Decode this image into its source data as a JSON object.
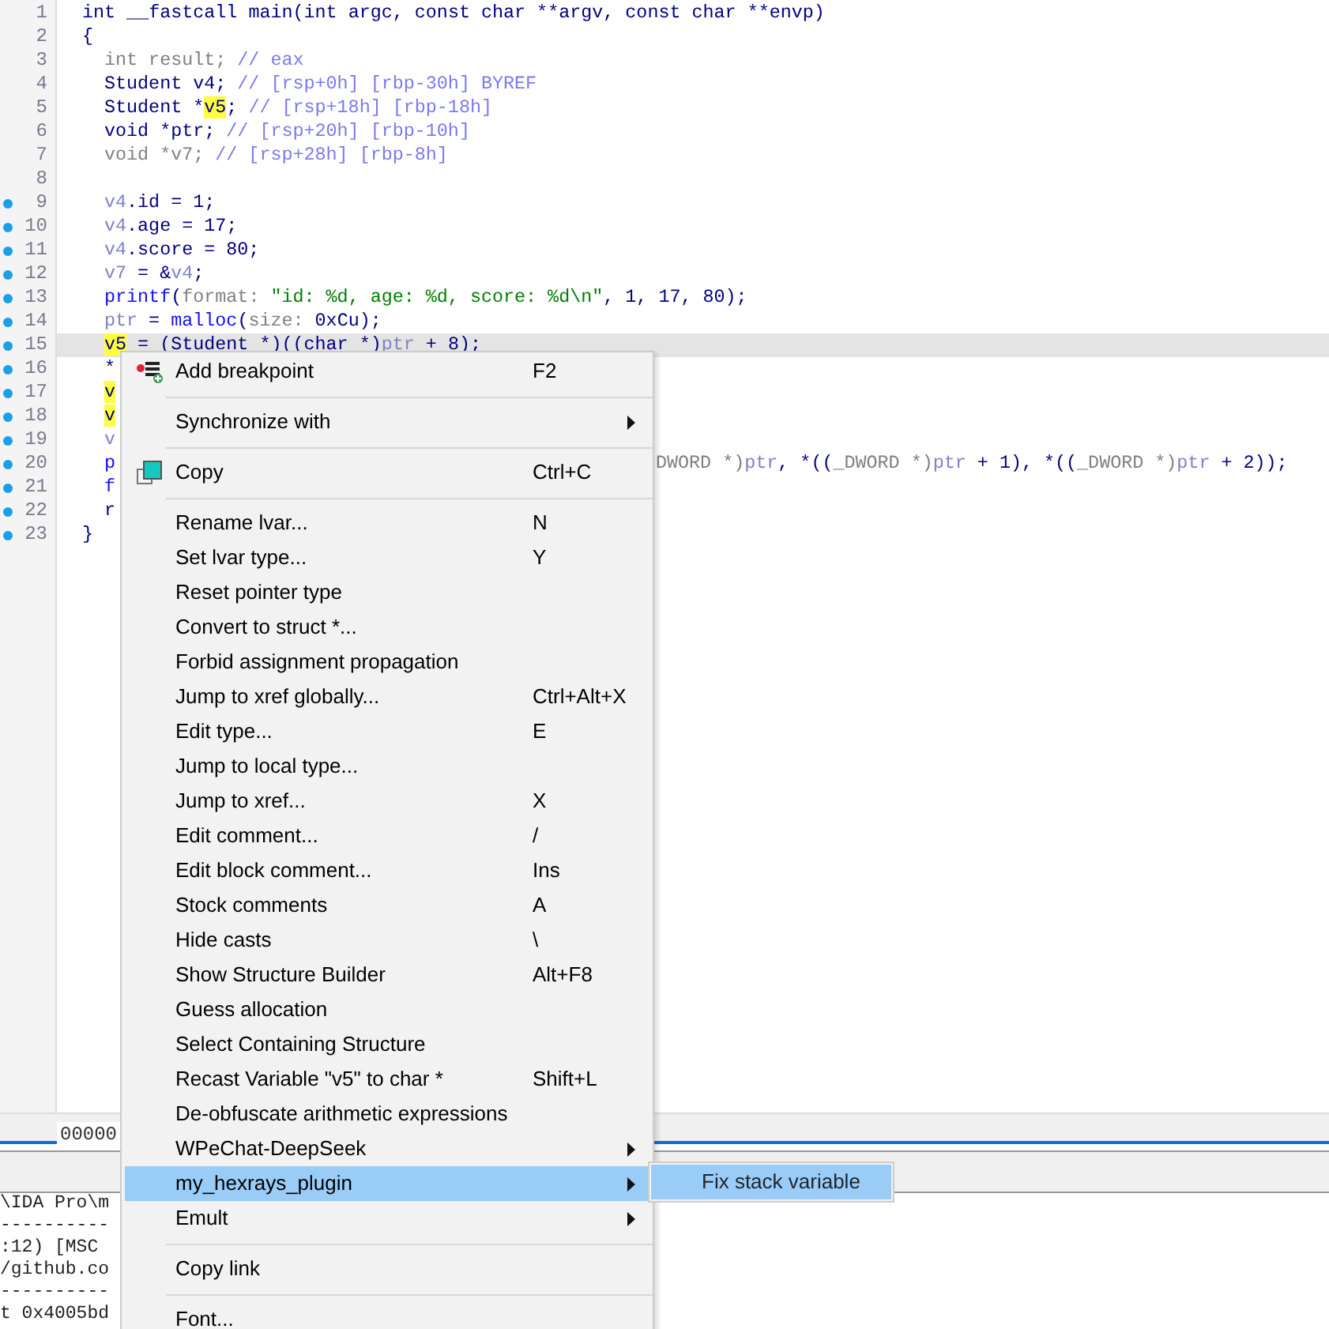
{
  "code_lines": [
    {
      "number": "1",
      "has_address": false,
      "current": false,
      "tokens": [
        {
          "text": "int __fastcall main(int argc, const char **argv, const char **envp)",
          "kind": "kw"
        }
      ]
    },
    {
      "number": "2",
      "has_address": false,
      "current": false,
      "tokens": [
        {
          "text": "{",
          "kind": "kw"
        }
      ]
    },
    {
      "number": "3",
      "has_address": false,
      "current": false,
      "indented": true,
      "tokens": [
        {
          "text": "int result; ",
          "kind": "dim"
        },
        {
          "text": "// eax",
          "kind": "cmt"
        }
      ]
    },
    {
      "number": "4",
      "has_address": false,
      "current": false,
      "indented": true,
      "tokens": [
        {
          "text": "Student v4; ",
          "kind": "kw"
        },
        {
          "text": "// [rsp+0h] [rbp-30h] BYREF",
          "kind": "cmt"
        }
      ]
    },
    {
      "number": "5",
      "has_address": false,
      "current": false,
      "indented": true,
      "tokens": [
        {
          "text": "Student *",
          "kind": "kw"
        },
        {
          "text": "v5",
          "kind": "match"
        },
        {
          "text": "; ",
          "kind": "kw"
        },
        {
          "text": "// [rsp+18h] [rbp-18h]",
          "kind": "cmt"
        }
      ]
    },
    {
      "number": "6",
      "has_address": false,
      "current": false,
      "indented": true,
      "tokens": [
        {
          "text": "void *ptr; ",
          "kind": "kw"
        },
        {
          "text": "// [rsp+20h] [rbp-10h]",
          "kind": "cmt"
        }
      ]
    },
    {
      "number": "7",
      "has_address": false,
      "current": false,
      "indented": true,
      "tokens": [
        {
          "text": "void *v7; ",
          "kind": "dim"
        },
        {
          "text": "// [rsp+28h] [rbp-8h]",
          "kind": "cmt"
        }
      ]
    },
    {
      "number": "8",
      "has_address": false,
      "current": false
    },
    {
      "number": "9",
      "has_address": true,
      "current": false,
      "indented": true,
      "tokens": [
        {
          "text": "v4",
          "kind": "var"
        },
        {
          "text": ".id = 1;",
          "kind": "kw"
        }
      ]
    },
    {
      "number": "10",
      "has_address": true,
      "current": false,
      "indented": true,
      "tokens": [
        {
          "text": "v4",
          "kind": "var"
        },
        {
          "text": ".age = 17;",
          "kind": "kw"
        }
      ]
    },
    {
      "number": "11",
      "has_address": true,
      "current": false,
      "indented": true,
      "tokens": [
        {
          "text": "v4",
          "kind": "var"
        },
        {
          "text": ".score = 80;",
          "kind": "kw"
        }
      ]
    },
    {
      "number": "12",
      "has_address": true,
      "current": false,
      "indented": true,
      "tokens": [
        {
          "text": "v7",
          "kind": "var"
        },
        {
          "text": " = &",
          "kind": "kw"
        },
        {
          "text": "v4",
          "kind": "var"
        },
        {
          "text": ";",
          "kind": "kw"
        }
      ]
    },
    {
      "number": "13",
      "has_address": true,
      "current": false,
      "indented": true,
      "tokens": [
        {
          "text": "printf",
          "kind": "fn"
        },
        {
          "text": "(",
          "kind": "kw"
        },
        {
          "text": "format: ",
          "kind": "dim"
        },
        {
          "text": "\"id: %d, age: %d, score: %d\\n\"",
          "kind": "str"
        },
        {
          "text": ", 1, 17, 80);",
          "kind": "kw"
        }
      ]
    },
    {
      "number": "14",
      "has_address": true,
      "current": false,
      "indented": true,
      "tokens": [
        {
          "text": "ptr",
          "kind": "var"
        },
        {
          "text": " = ",
          "kind": "kw"
        },
        {
          "text": "malloc",
          "kind": "fn"
        },
        {
          "text": "(",
          "kind": "kw"
        },
        {
          "text": "size: ",
          "kind": "dim"
        },
        {
          "text": "0xCu",
          "kind": "kw"
        },
        {
          "text": ");",
          "kind": "kw"
        }
      ]
    },
    {
      "number": "15",
      "has_address": true,
      "current": true,
      "indented": true,
      "tokens": [
        {
          "text": "v5",
          "kind": "match"
        },
        {
          "text": " = (Student *)((char *)",
          "kind": "kw"
        },
        {
          "text": "ptr",
          "kind": "var"
        },
        {
          "text": " + 8);",
          "kind": "kw"
        }
      ]
    },
    {
      "number": "16",
      "has_address": true,
      "current": false,
      "indented": true,
      "tokens": [
        {
          "text": "*",
          "kind": "kw"
        }
      ]
    },
    {
      "number": "17",
      "has_address": true,
      "current": false,
      "indented": true,
      "tokens": [
        {
          "text": "v",
          "kind": "match"
        }
      ]
    },
    {
      "number": "18",
      "has_address": true,
      "current": false,
      "indented": true,
      "tokens": [
        {
          "text": "v",
          "kind": "match"
        }
      ]
    },
    {
      "number": "19",
      "has_address": true,
      "current": false,
      "indented": true,
      "tokens": [
        {
          "text": "v",
          "kind": "var"
        }
      ]
    },
    {
      "number": "20",
      "has_address": true,
      "current": false,
      "indented": true,
      "tokens": [
        {
          "text": "p",
          "kind": "fn"
        }
      ],
      "tail": [
        {
          "text": "DWORD *)",
          "kind": "dim"
        },
        {
          "text": "ptr",
          "kind": "var"
        },
        {
          "text": ", *((",
          "kind": "kw"
        },
        {
          "text": "_DWORD *)",
          "kind": "dim"
        },
        {
          "text": "ptr",
          "kind": "var"
        },
        {
          "text": " + 1), *((",
          "kind": "kw"
        },
        {
          "text": "_DWORD *)",
          "kind": "dim"
        },
        {
          "text": "ptr",
          "kind": "var"
        },
        {
          "text": " + 2));",
          "kind": "kw"
        }
      ]
    },
    {
      "number": "21",
      "has_address": true,
      "current": false,
      "indented": true,
      "tokens": [
        {
          "text": "f",
          "kind": "fn"
        }
      ]
    },
    {
      "number": "22",
      "has_address": true,
      "current": false,
      "indented": true,
      "tokens": [
        {
          "text": "r",
          "kind": "kw"
        }
      ]
    },
    {
      "number": "23",
      "has_address": true,
      "current": false,
      "tokens": [
        {
          "text": "}",
          "kind": "kw"
        }
      ]
    }
  ],
  "status_address": "00000",
  "output_lines": [
    "\\IDA Pro\\m",
    "----------",
    ":12) [MSC",
    "/github.co",
    "----------",
    "t 0x4005bd"
  ],
  "context_menu": [
    {
      "kind": "breakpoint",
      "label": "Add breakpoint",
      "shortcut": "F2",
      "has_submenu": false,
      "selected": false
    },
    {
      "kind": "separator"
    },
    {
      "kind": "item",
      "label": "Synchronize with",
      "has_submenu": true,
      "selected": false
    },
    {
      "kind": "separator"
    },
    {
      "kind": "copy",
      "label": "Copy",
      "shortcut": "Ctrl+C",
      "has_submenu": false,
      "selected": false
    },
    {
      "kind": "separator"
    },
    {
      "kind": "item",
      "label": "Rename lvar...",
      "shortcut": "N",
      "has_submenu": false,
      "selected": false
    },
    {
      "kind": "item",
      "label": "Set lvar type...",
      "shortcut": "Y",
      "has_submenu": false,
      "selected": false
    },
    {
      "kind": "item",
      "label": "Reset pointer type",
      "has_submenu": false,
      "selected": false
    },
    {
      "kind": "item",
      "label": "Convert to struct *...",
      "has_submenu": false,
      "selected": false
    },
    {
      "kind": "item",
      "label": "Forbid assignment propagation",
      "has_submenu": false,
      "selected": false
    },
    {
      "kind": "item",
      "label": "Jump to xref globally...",
      "shortcut": "Ctrl+Alt+X",
      "has_submenu": false,
      "selected": false
    },
    {
      "kind": "item",
      "label": "Edit type...",
      "shortcut": "E",
      "has_submenu": false,
      "selected": false
    },
    {
      "kind": "item",
      "label": "Jump to local type...",
      "has_submenu": false,
      "selected": false
    },
    {
      "kind": "item",
      "label": "Jump to xref...",
      "shortcut": "X",
      "has_submenu": false,
      "selected": false
    },
    {
      "kind": "item",
      "label": "Edit comment...",
      "shortcut": "/",
      "has_submenu": false,
      "selected": false
    },
    {
      "kind": "item",
      "label": "Edit block comment...",
      "shortcut": "Ins",
      "has_submenu": false,
      "selected": false
    },
    {
      "kind": "item",
      "label": "Stock comments",
      "shortcut": "A",
      "has_submenu": false,
      "selected": false
    },
    {
      "kind": "item",
      "label": "Hide casts",
      "shortcut": "\\",
      "has_submenu": false,
      "selected": false
    },
    {
      "kind": "item",
      "label": "Show Structure Builder",
      "shortcut": "Alt+F8",
      "has_submenu": false,
      "selected": false
    },
    {
      "kind": "item",
      "label": "Guess allocation",
      "has_submenu": false,
      "selected": false
    },
    {
      "kind": "item",
      "label": "Select Containing Structure",
      "has_submenu": false,
      "selected": false
    },
    {
      "kind": "item",
      "label": "Recast Variable \"v5\" to char *",
      "shortcut": "Shift+L",
      "has_submenu": false,
      "selected": false
    },
    {
      "kind": "item",
      "label": "De-obfuscate arithmetic expressions",
      "has_submenu": false,
      "selected": false
    },
    {
      "kind": "item",
      "label": "WPeChat-DeepSeek",
      "has_submenu": true,
      "selected": false
    },
    {
      "kind": "item",
      "label": "my_hexrays_plugin",
      "has_submenu": true,
      "selected": true
    },
    {
      "kind": "item",
      "label": "Emult",
      "has_submenu": true,
      "selected": false
    },
    {
      "kind": "separator"
    },
    {
      "kind": "item",
      "label": "Copy link",
      "has_submenu": false,
      "selected": false
    },
    {
      "kind": "separator"
    },
    {
      "kind": "item",
      "label": "Font...",
      "has_submenu": false,
      "selected": false
    }
  ],
  "submenu": [
    {
      "label": "Fix stack variable",
      "selected": true
    }
  ]
}
